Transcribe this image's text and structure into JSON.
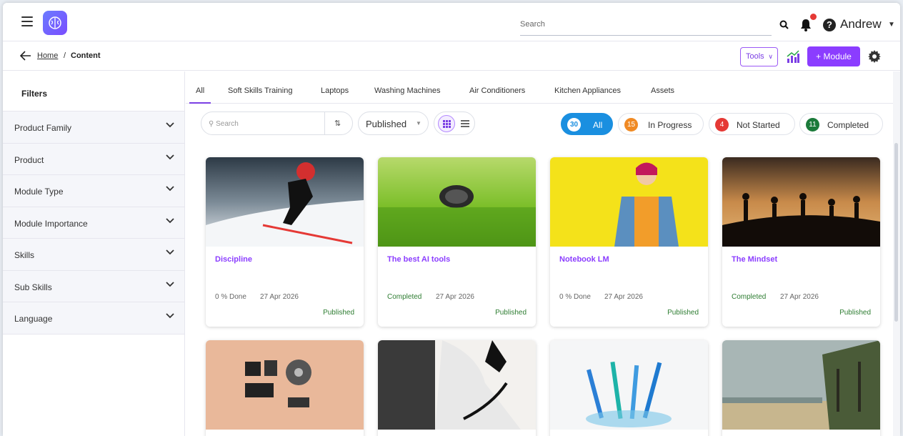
{
  "header": {
    "search_placeholder": "Search",
    "user_name": "Andrew"
  },
  "breadcrumb": {
    "home": "Home",
    "separator": "/",
    "current": "Content"
  },
  "toolbar": {
    "tools_label": "Tools",
    "module_label": "+ Module"
  },
  "sidebar": {
    "title": "Filters",
    "items": [
      {
        "label": "Product Family"
      },
      {
        "label": "Product"
      },
      {
        "label": "Module Type"
      },
      {
        "label": "Module Importance"
      },
      {
        "label": "Skills"
      },
      {
        "label": "Sub Skills"
      },
      {
        "label": "Language"
      }
    ]
  },
  "tabs": [
    {
      "label": "All",
      "active": true
    },
    {
      "label": "Soft Skills Training"
    },
    {
      "label": "Laptops"
    },
    {
      "label": "Washing Machines"
    },
    {
      "label": "Air Conditioners"
    },
    {
      "label": "Kitchen Appliances"
    },
    {
      "label": "Assets"
    }
  ],
  "controls": {
    "search_placeholder": "Search",
    "status_value": "Published"
  },
  "status_pills": [
    {
      "count": "30",
      "label": "All",
      "color": "#1a8fe0",
      "active": true
    },
    {
      "count": "15",
      "label": "In Progress",
      "color": "#f08a24"
    },
    {
      "count": "4",
      "label": "Not Started",
      "color": "#e53935"
    },
    {
      "count": "11",
      "label": "Completed",
      "color": "#1b7a3a"
    }
  ],
  "cards": [
    {
      "title": "Discipline",
      "progress": "0 % Done",
      "date": "27 Apr 2026",
      "status": "Published"
    },
    {
      "title": "The best AI tools",
      "progress": "Completed",
      "date": "27 Apr 2026",
      "status": "Published"
    },
    {
      "title": "Notebook LM",
      "progress": "0 % Done",
      "date": "27 Apr 2026",
      "status": "Published"
    },
    {
      "title": "The Mindset",
      "progress": "Completed",
      "date": "27 Apr 2026",
      "status": "Published"
    }
  ],
  "colors": {
    "accent": "#8b3dff",
    "active_pill": "#1a8fe0",
    "published": "#2e7d32"
  }
}
